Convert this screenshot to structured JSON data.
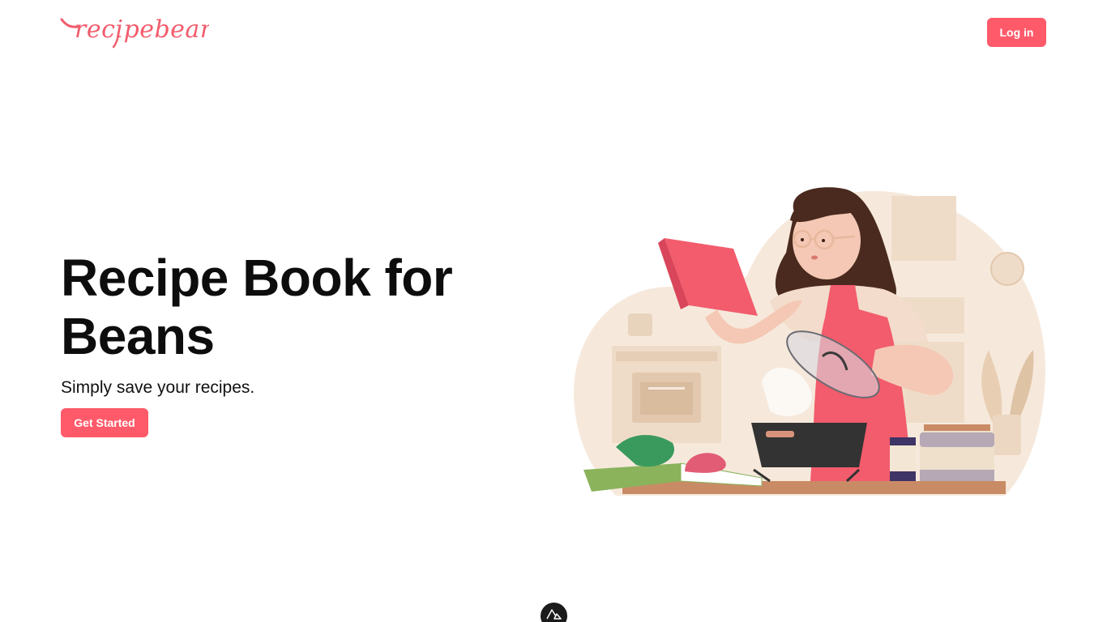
{
  "header": {
    "logo_text": "recipebean",
    "login_label": "Log in"
  },
  "hero": {
    "title_line1": "Recipe Book for",
    "title_line2": "Beans",
    "subtitle": "Simply save your recipes.",
    "cta_label": "Get Started"
  },
  "colors": {
    "brand": "#ff5a6a",
    "logo": "#f25c6c",
    "text": "#0d0d0d",
    "illustration_bg": "#f6e9dc"
  },
  "icons": {
    "devtools_badge": "nuxt-logo-icon"
  }
}
